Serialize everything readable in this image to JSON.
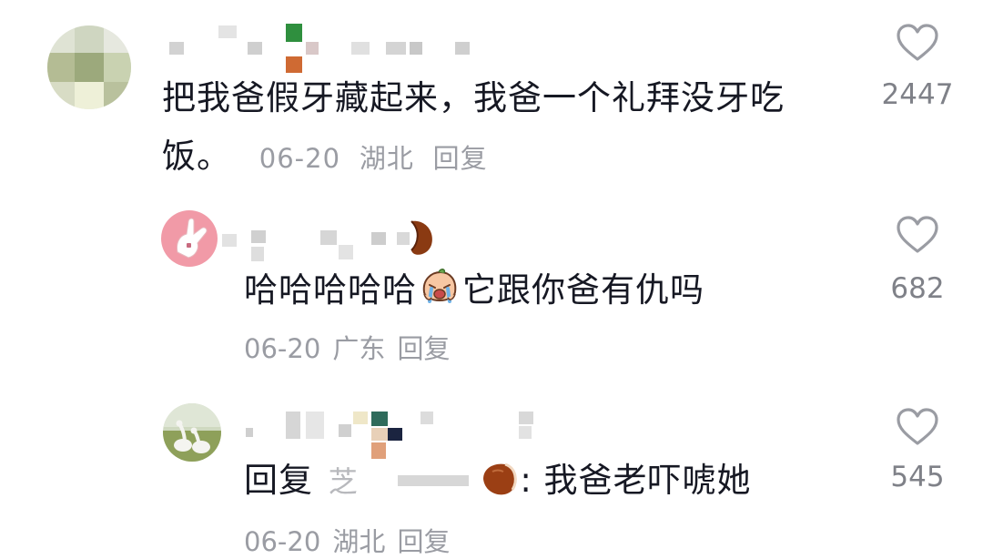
{
  "comments": [
    {
      "text_line1": "把我爸假牙藏起来，我爸一个礼拜没牙吃",
      "text_line2": "饭。",
      "date": "06-20",
      "location": "湖北",
      "reply_label": "回复",
      "likes": "2447"
    },
    {
      "text_before_emoji": "哈哈哈哈哈",
      "emoji": "crying-face-emoji",
      "text_after_emoji": "它跟你爸有仇吗",
      "date": "06-20",
      "location": "广东",
      "reply_label": "回复",
      "likes": "682"
    },
    {
      "reply_prefix": "回复",
      "reply_to_partial": "芝",
      "text": ": 我爸老吓唬她",
      "date": "06-20",
      "location": "湖北",
      "reply_label": "回复",
      "likes": "545"
    }
  ],
  "icons": {
    "like": "heart-outline-icon"
  }
}
